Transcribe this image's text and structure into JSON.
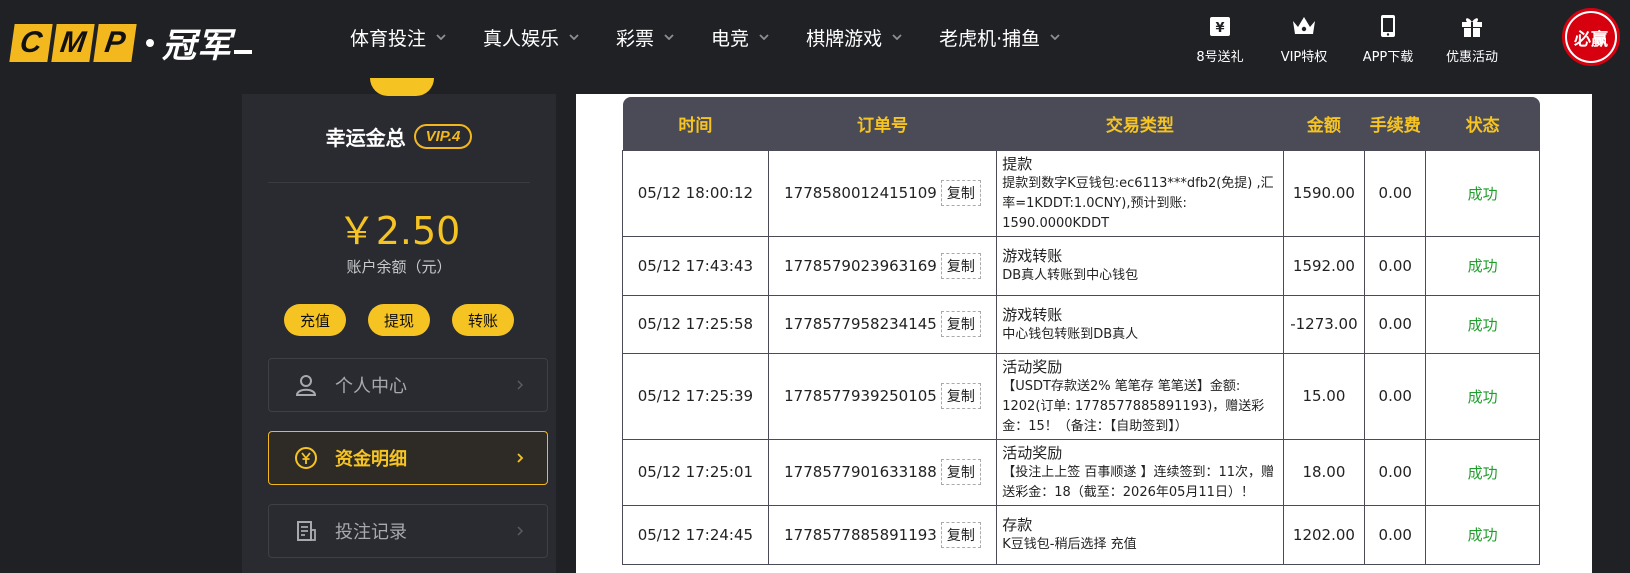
{
  "header": {
    "logo_letters": [
      "C",
      "M",
      "P"
    ],
    "logo_cn": "冠军",
    "nav": [
      {
        "label": "体育投注"
      },
      {
        "label": "真人娱乐"
      },
      {
        "label": "彩票"
      },
      {
        "label": "电竞"
      },
      {
        "label": "棋牌游戏"
      },
      {
        "label": "老虎机·捕鱼"
      }
    ],
    "tools": [
      {
        "label": "8号送礼",
        "icon": "gift-ticket-icon"
      },
      {
        "label": "VIP特权",
        "icon": "crown-icon"
      },
      {
        "label": "APP下载",
        "icon": "phone-icon"
      },
      {
        "label": "优惠活动",
        "icon": "gift-box-icon"
      }
    ],
    "avatar_text": "必赢"
  },
  "sidebar": {
    "username": "幸运金总",
    "vip_label": "VIP.4",
    "balance": "￥2.50",
    "balance_label": "账户余额（元）",
    "actions": [
      "充值",
      "提现",
      "转账"
    ],
    "menu": [
      {
        "label": "个人中心",
        "icon": "user-icon"
      },
      {
        "label": "资金明细",
        "icon": "yuan-coin-icon",
        "active": true
      },
      {
        "label": "投注记录",
        "icon": "document-icon"
      }
    ]
  },
  "table": {
    "headers": [
      "时间",
      "订单号",
      "交易类型",
      "金额",
      "手续费",
      "状态"
    ],
    "copy_label": "复制",
    "rows": [
      {
        "time": "05/12 18:00:12",
        "order": "1778580012415109",
        "type": "提款",
        "desc": "提款到数字K豆钱包:ec6113***dfb2(免提) ,汇率=1KDDT:1.0CNY),预计到账: 1590.0000KDDT",
        "amount": "1590.00",
        "fee": "0.00",
        "status": "成功"
      },
      {
        "time": "05/12 17:43:43",
        "order": "1778579023963169",
        "type": "游戏转账",
        "desc": "DB真人转账到中心钱包",
        "amount": "1592.00",
        "fee": "0.00",
        "status": "成功"
      },
      {
        "time": "05/12 17:25:58",
        "order": "1778577958234145",
        "type": "游戏转账",
        "desc": "中心钱包转账到DB真人",
        "amount": "-1273.00",
        "fee": "0.00",
        "status": "成功"
      },
      {
        "time": "05/12 17:25:39",
        "order": "1778577939250105",
        "type": "活动奖励",
        "desc": "【USDT存款送2% 笔笔存 笔笔送】金额: 1202(订单: 1778577885891193)，赠送彩金：15！（备注：【自助签到】）",
        "amount": "15.00",
        "fee": "0.00",
        "status": "成功"
      },
      {
        "time": "05/12 17:25:01",
        "order": "1778577901633188",
        "type": "活动奖励",
        "desc": "【投注上上签 百事顺遂 】连续签到：11次，赠送彩金：18（截至：2026年05月11日）！",
        "amount": "18.00",
        "fee": "0.00",
        "status": "成功"
      },
      {
        "time": "05/12 17:24:45",
        "order": "1778577885891193",
        "type": "存款",
        "desc": "K豆钱包-稍后选择 充值",
        "amount": "1202.00",
        "fee": "0.00",
        "status": "成功"
      }
    ]
  }
}
